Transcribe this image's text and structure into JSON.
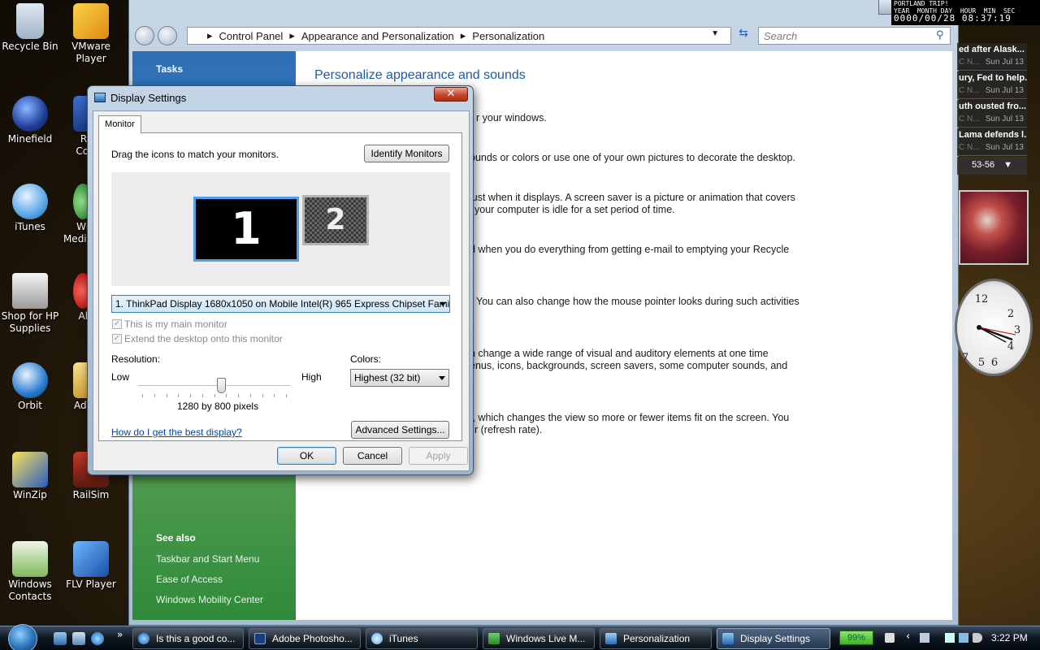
{
  "desktop": {
    "icons": [
      {
        "label": "Recycle Bin"
      },
      {
        "label": "VMware Player"
      },
      {
        "label": "Minefield"
      },
      {
        "label": "Re Cor"
      },
      {
        "label": "iTunes"
      },
      {
        "label": "Wir Media"
      },
      {
        "label": "Shop for HP Supplies"
      },
      {
        "label": "Al"
      },
      {
        "label": "Orbit"
      },
      {
        "label": "Ado"
      },
      {
        "label": "WinZip"
      },
      {
        "label": "RailSim"
      },
      {
        "label": "Windows Contacts"
      },
      {
        "label": "FLV Player"
      }
    ]
  },
  "explorer": {
    "breadcrumb": [
      "Control Panel",
      "Appearance and Personalization",
      "Personalization"
    ],
    "search_placeholder": "Search",
    "sidebar": {
      "tasks": "Tasks",
      "see_also": "See also",
      "links": [
        "Taskbar and Start Menu",
        "Ease of Access",
        "Windows Mobility Center"
      ]
    },
    "content": {
      "heading": "Personalize appearance and sounds",
      "lines": [
        "r your windows.",
        "ounds or colors or use one of your own pictures to decorate the desktop.",
        "just when it displays. A screen saver is a picture or animation that covers",
        "your computer is idle for a set period of time.",
        "d when you do everything from getting e-mail to emptying your Recycle",
        "You can also change how the mouse pointer looks during such activities",
        "n change a wide range of visual and auditory elements at one time",
        "enus, icons, backgrounds, screen savers, some computer sounds, and",
        "r, which changes the view so more or fewer items fit on the screen. You",
        "r (refresh rate)."
      ]
    }
  },
  "dialog": {
    "title": "Display Settings",
    "close": "✕",
    "tab": "Monitor",
    "instruction": "Drag the icons to match your monitors.",
    "identify": "Identify Monitors",
    "monitor1": "1",
    "monitor2": "2",
    "monitor_select": "1. ThinkPad Display 1680x1050 on Mobile Intel(R) 965 Express Chipset Famil",
    "main_monitor": "This is my main monitor",
    "extend": "Extend the desktop onto this monitor",
    "resolution_label": "Resolution:",
    "low": "Low",
    "high": "High",
    "resolution_value": "1280 by 800 pixels",
    "resolution_slider_fraction": 0.55,
    "colors_label": "Colors:",
    "colors_value": "Highest (32 bit)",
    "help_link": "How do I get the best display?",
    "advanced": "Advanced Settings...",
    "ok": "OK",
    "cancel": "Cancel",
    "apply": "Apply"
  },
  "clock_widget": {
    "title": "PORTLAND TRIP!",
    "headers": "YEAR  MONTH DAY  HOUR  MIN  SEC",
    "digits": "0000/00/28 08:37:19"
  },
  "news": [
    {
      "title": "ed after Alask...",
      "source": "C N...",
      "date": "Sun Jul 13"
    },
    {
      "title": "ury, Fed to help...",
      "source": "C N...",
      "date": "Sun Jul 13"
    },
    {
      "title": "uth ousted fro...",
      "source": "C N...",
      "date": "Sun Jul 13"
    },
    {
      "title": "Lama defends l...",
      "source": "C N...",
      "date": "Sun Jul 13"
    }
  ],
  "news_nav": "53-56",
  "taskbar": {
    "buttons": [
      "Is this a good co...",
      "Adobe Photosho...",
      "iTunes",
      "Windows Live M...",
      "Personalization",
      "Display Settings"
    ],
    "battery": "99%",
    "time": "3:22 PM"
  }
}
